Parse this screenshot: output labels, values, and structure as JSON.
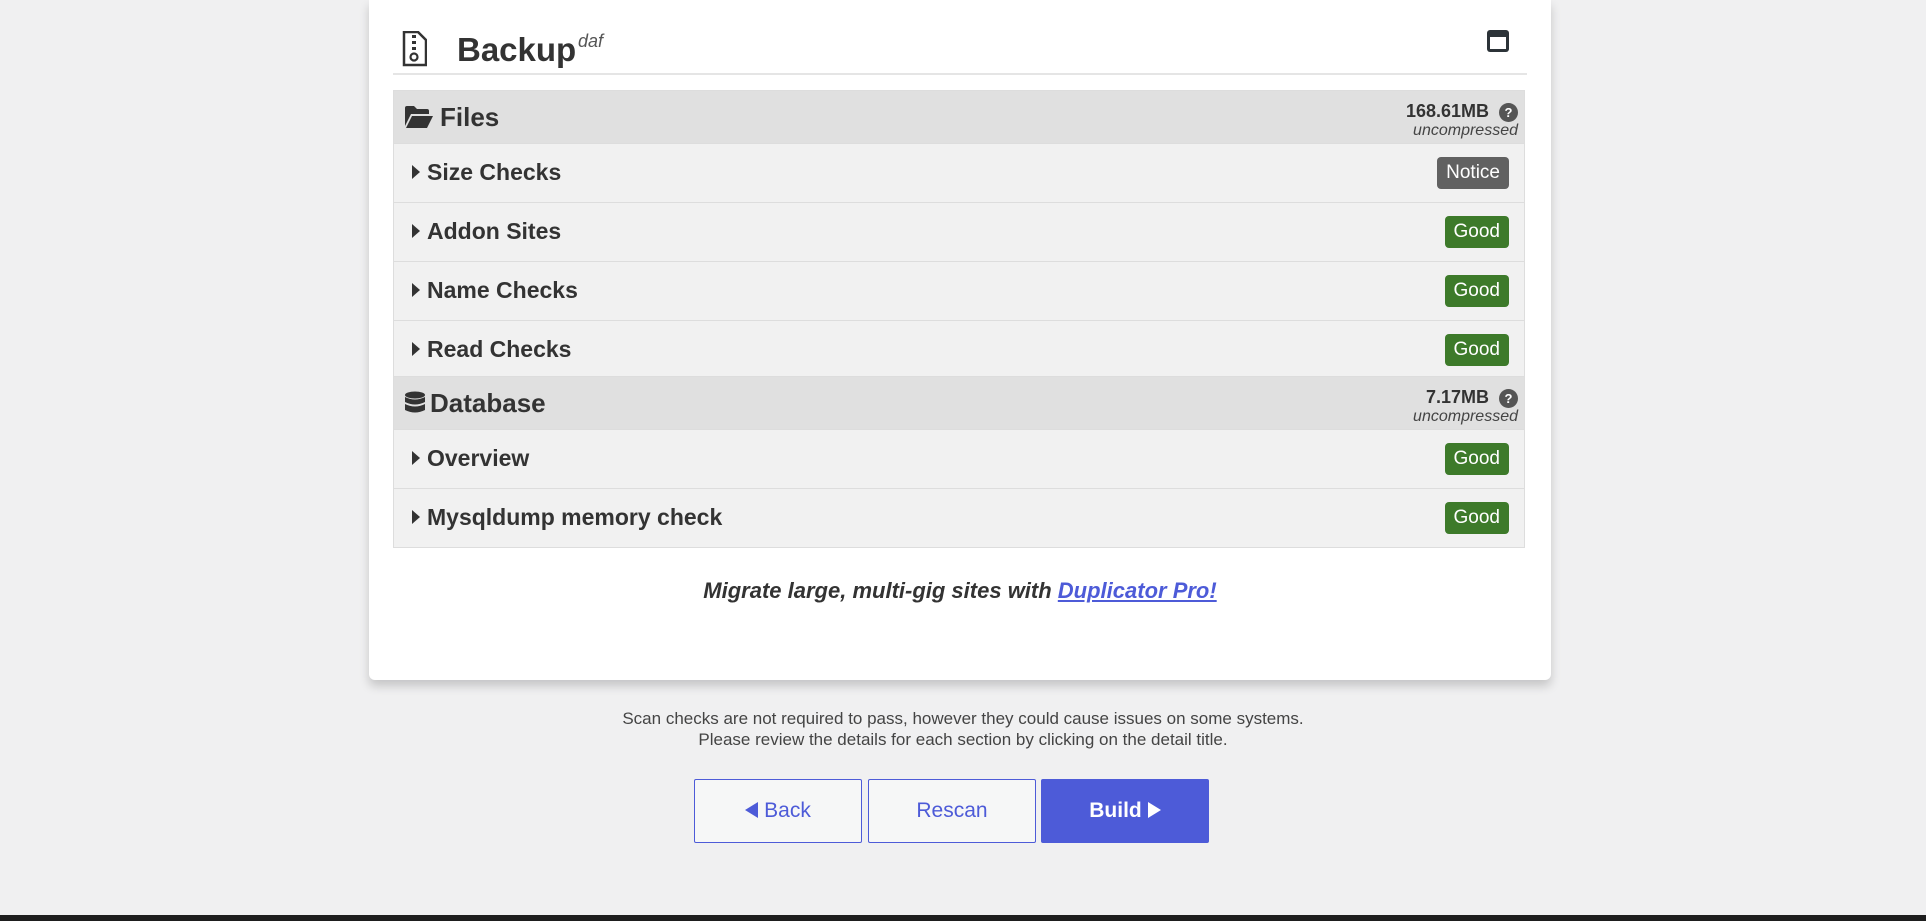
{
  "backup": {
    "title": "Backup",
    "subtitle": "daf"
  },
  "files": {
    "title": "Files",
    "size": "168.61MB",
    "help": "?",
    "size_note": "uncompressed",
    "rows": [
      {
        "label": "Size Checks",
        "status": "Notice"
      },
      {
        "label": "Addon Sites",
        "status": "Good"
      },
      {
        "label": "Name Checks",
        "status": "Good"
      },
      {
        "label": "Read Checks",
        "status": "Good"
      }
    ]
  },
  "database": {
    "title": "Database",
    "size": "7.17MB",
    "help": "?",
    "size_note": "uncompressed",
    "rows": [
      {
        "label": "Overview",
        "status": "Good"
      },
      {
        "label": "Mysqldump memory check",
        "status": "Good"
      }
    ]
  },
  "promo": {
    "text": "Migrate large, multi-gig sites with ",
    "link": "Duplicator Pro!"
  },
  "info": {
    "line1": "Scan checks are not required to pass, however they could cause issues on some systems.",
    "line2": "Please review the details for each section by clicking on the detail title."
  },
  "buttons": {
    "back": "Back",
    "rescan": "Rescan",
    "build": "Build"
  },
  "colors": {
    "accent": "#4d5bd8",
    "good": "#3d7a2a",
    "notice": "#616161"
  }
}
